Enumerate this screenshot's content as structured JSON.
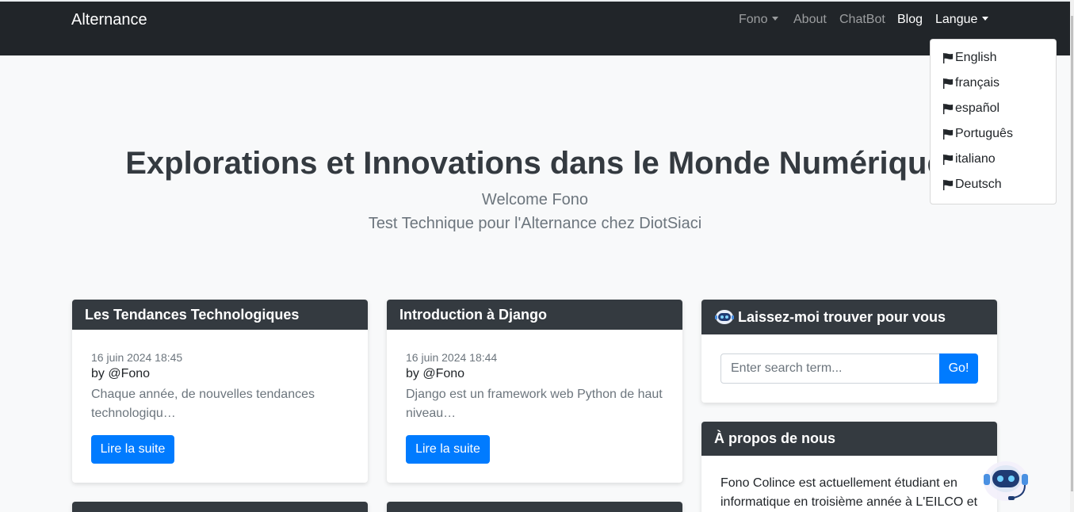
{
  "navbar": {
    "brand": "Alternance",
    "items": [
      {
        "label": "Fono",
        "dropdown": true,
        "active": false
      },
      {
        "label": "About",
        "dropdown": false,
        "active": false
      },
      {
        "label": "ChatBot",
        "dropdown": false,
        "active": false
      },
      {
        "label": "Blog",
        "dropdown": false,
        "active": true
      },
      {
        "label": "Langue",
        "dropdown": true,
        "active": true
      }
    ]
  },
  "language_menu": {
    "icon": "flag-icon",
    "items": [
      "English",
      "français",
      "español",
      "Português",
      "italiano",
      "Deutsch"
    ]
  },
  "hero": {
    "title": "Explorations et Innovations dans le Monde Numérique",
    "subtitle": "Welcome Fono",
    "tagline": "Test Technique pour l'Alternance chez DiotSiaci"
  },
  "posts": [
    {
      "title": "Les Tendances Technologiques",
      "date": "16 juin 2024 18:45",
      "author": "by @Fono",
      "excerpt": "Chaque année, de nouvelles tendances technologiqu…",
      "button": "Lire la suite"
    },
    {
      "title": "Introduction à Django",
      "date": "16 juin 2024 18:44",
      "author": "by @Fono",
      "excerpt": "Django est un framework web Python de haut niveau…",
      "button": "Lire la suite"
    }
  ],
  "search_widget": {
    "title": "Laissez-moi trouver pour vous",
    "icon": "robot-icon",
    "placeholder": "Enter search term...",
    "button": "Go!"
  },
  "about_widget": {
    "title": "À propos de nous",
    "text": "Fono Colince est actuellement étudiant en informatique en troisième année à L'EILCO et"
  },
  "chatbot": {
    "icon": "chatbot-robot-icon"
  },
  "colors": {
    "navbar": "#212529",
    "card_header": "#343a40",
    "primary": "#007bff",
    "background": "#f8f9fa"
  }
}
